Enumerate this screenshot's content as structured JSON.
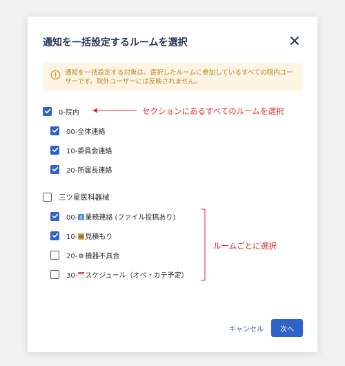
{
  "dialog": {
    "title": "通知を一括設定するルームを選択",
    "notice": "通知を一括設定する対象は、選択したルームに参加しているすべての院内ユーザーです。院外ユーザーには反映されません。",
    "cancel_label": "キャンセル",
    "next_label": "次へ"
  },
  "sections": [
    {
      "label": "0-院内",
      "checked": true,
      "rooms": [
        {
          "label": "00-全体連絡",
          "checked": true
        },
        {
          "label": "10-委員会連絡",
          "checked": true
        },
        {
          "label": "20-所属長連絡",
          "checked": true
        }
      ]
    },
    {
      "label": "三ツ星医科器械",
      "checked": false,
      "rooms": [
        {
          "prefix": "00-",
          "label": "業務連絡 (ファイル投稿あり)",
          "icon": "info-emoji-icon",
          "checked": true
        },
        {
          "prefix": "10-",
          "label": "見積もり",
          "icon": "ledger-emoji-icon",
          "checked": true
        },
        {
          "prefix": "20-",
          "label": "機器不具合",
          "icon": "gear-emoji-icon",
          "checked": false
        },
        {
          "prefix": "30-",
          "label": "スケジュール（オペ・カテ予定）",
          "icon": "calendar-emoji-icon",
          "checked": false
        }
      ]
    }
  ],
  "annotations": {
    "section_note": "セクションにあるすべてのルームを選択",
    "group_note": "ルームごとに選択"
  },
  "colors": {
    "accent": "#2f63c9",
    "title": "#233457",
    "notice_bg": "#fdf4e3",
    "notice_text": "#b8862b",
    "annotation": "#e02a2a"
  }
}
